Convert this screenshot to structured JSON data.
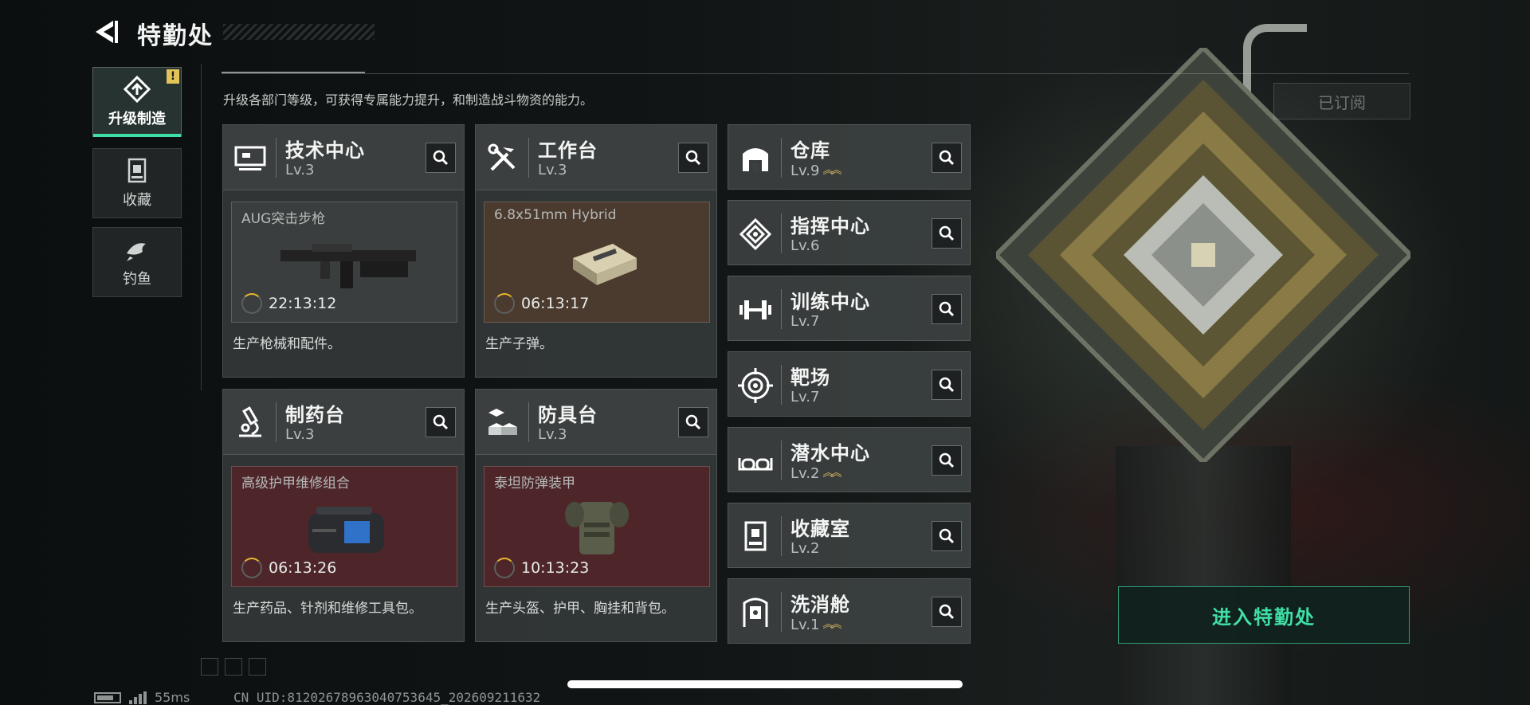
{
  "header": {
    "title": "特勤处",
    "subtitle": "升级各部门等级，可获得专属能力提升，和制造战斗物资的能力。"
  },
  "subscribe": {
    "label": "已订阅"
  },
  "tabs": [
    {
      "label": "升级制造",
      "icon": "upgrade-icon",
      "active": true,
      "badge": "!"
    },
    {
      "label": "收藏",
      "icon": "collection-icon",
      "active": false
    },
    {
      "label": "钓鱼",
      "icon": "fish-icon",
      "active": false
    }
  ],
  "workshops": [
    {
      "name": "技术中心",
      "level": "Lv.3",
      "icon": "computer-icon",
      "product": "AUG突击步枪",
      "timer": "22:13:12",
      "desc": "生产枪械和配件。",
      "box": "grey"
    },
    {
      "name": "工作台",
      "level": "Lv.3",
      "icon": "tools-icon",
      "product": "6.8x51mm Hybrid",
      "timer": "06:13:17",
      "desc": "生产子弹。",
      "box": "brown"
    },
    {
      "name": "制药台",
      "level": "Lv.3",
      "icon": "microscope-icon",
      "product": "高级护甲维修组合",
      "timer": "06:13:26",
      "desc": "生产药品、针剂和维修工具包。",
      "box": "red"
    },
    {
      "name": "防具台",
      "level": "Lv.3",
      "icon": "blocks-icon",
      "product": "泰坦防弹装甲",
      "timer": "10:13:23",
      "desc": "生产头盔、护甲、胸挂和背包。",
      "box": "red"
    }
  ],
  "departments": [
    {
      "name": "仓库",
      "level": "Lv.9",
      "upgrade": true,
      "icon": "warehouse-icon"
    },
    {
      "name": "指挥中心",
      "level": "Lv.6",
      "upgrade": false,
      "icon": "chip-icon"
    },
    {
      "name": "训练中心",
      "level": "Lv.7",
      "upgrade": false,
      "icon": "dumbbell-icon"
    },
    {
      "name": "靶场",
      "level": "Lv.7",
      "upgrade": false,
      "icon": "target-icon"
    },
    {
      "name": "潜水中心",
      "level": "Lv.2",
      "upgrade": true,
      "icon": "goggles-icon"
    },
    {
      "name": "收藏室",
      "level": "Lv.2",
      "upgrade": false,
      "icon": "collection-room-icon"
    },
    {
      "name": "洗消舱",
      "level": "Lv.1",
      "upgrade": true,
      "icon": "decontamination-icon"
    }
  ],
  "enter_button": {
    "label": "进入特勤处"
  },
  "status": {
    "ping": "55ms",
    "uid": "CN UID:81202678963040753645_202609211632"
  },
  "colors": {
    "accent": "#3fe0a6",
    "badge": "#e2c35a",
    "upgrade_arrow": "#d4b25c",
    "timer": "#e7b531"
  }
}
